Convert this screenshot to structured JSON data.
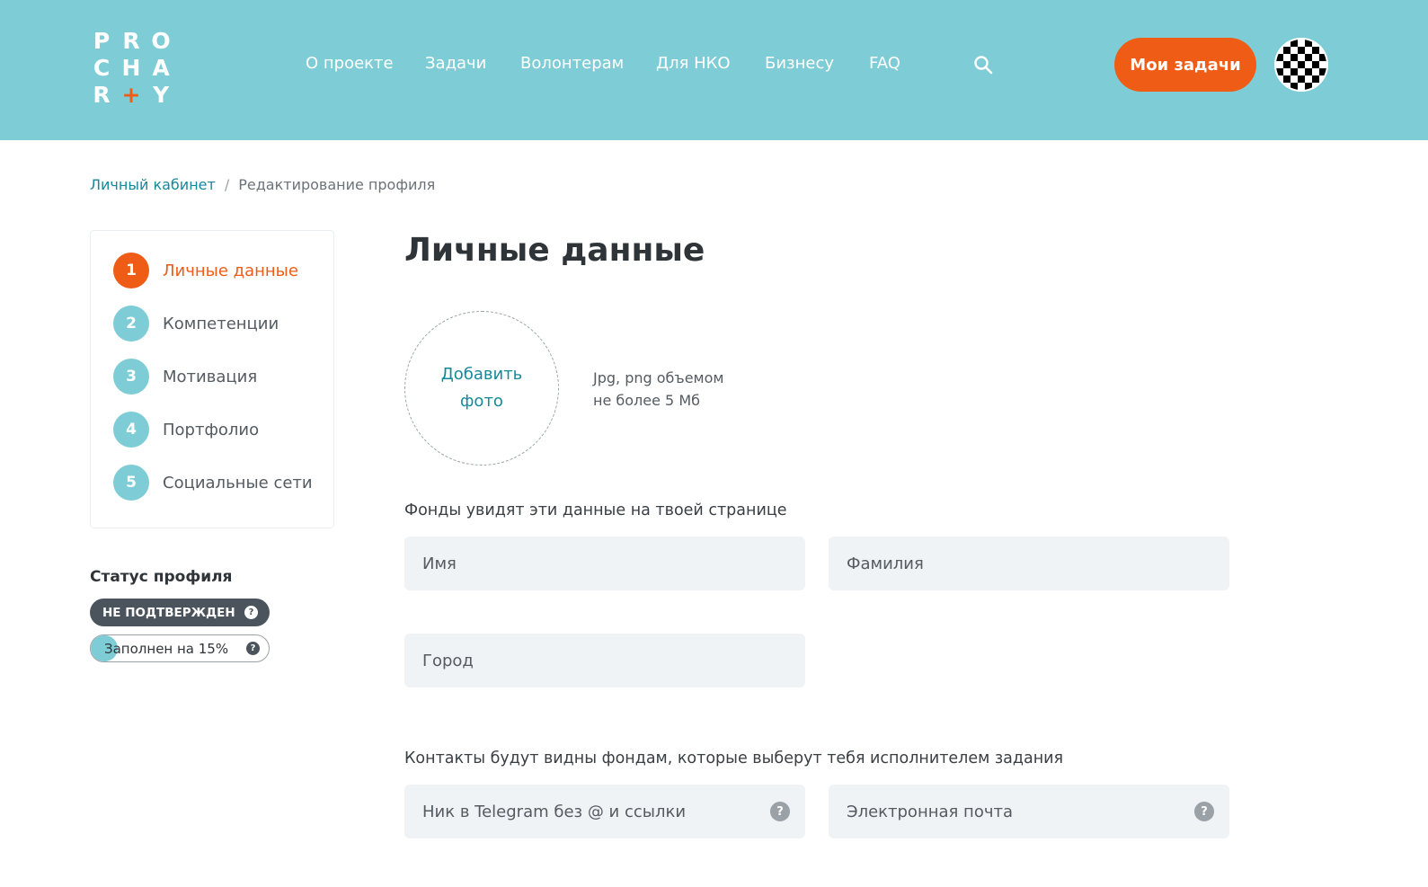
{
  "header": {
    "logo_rows": [
      [
        "P",
        "R",
        "O"
      ],
      [
        "C",
        "H",
        "A"
      ],
      [
        "R",
        "+",
        "Y"
      ]
    ],
    "nav": [
      "О проекте",
      "Задачи",
      "Волонтерам",
      "Для НКО",
      "Бизнесу",
      "FAQ"
    ],
    "my_tasks_button": "Мои задачи",
    "search_icon": "search-icon",
    "colors": {
      "header_bg": "#7ecdd6",
      "accent": "#ee5c16"
    }
  },
  "breadcrumb": {
    "home": "Личный кабинет",
    "separator": "/",
    "current": "Редактирование профиля"
  },
  "steps": [
    {
      "num": "1",
      "label": "Личные данные",
      "active": true
    },
    {
      "num": "2",
      "label": "Компетенции",
      "active": false
    },
    {
      "num": "3",
      "label": "Мотивация",
      "active": false
    },
    {
      "num": "4",
      "label": "Портфолио",
      "active": false
    },
    {
      "num": "5",
      "label": "Социальные сети",
      "active": false
    }
  ],
  "status": {
    "title": "Статус профиля",
    "badge": "НЕ ПОДТВЕРЖДЕН",
    "progress_text": "Заполнен на 15%",
    "progress_percent": 15,
    "help_glyph": "?"
  },
  "main": {
    "title": "Личные данные",
    "photo": {
      "label": "Добавить фото",
      "hint_line1": "Jpg, png объемом",
      "hint_line2": "не более 5 Мб"
    },
    "public_note": "Фонды увидят эти данные на твоей странице",
    "fields": {
      "first_name": "Имя",
      "last_name": "Фамилия",
      "city": "Город"
    },
    "contacts_note": "Контакты будут видны фондам, которые выберут тебя исполнителем задания",
    "contacts": {
      "telegram": "Ник в Telegram без @ и ссылки",
      "email": "Электронная почта"
    }
  }
}
